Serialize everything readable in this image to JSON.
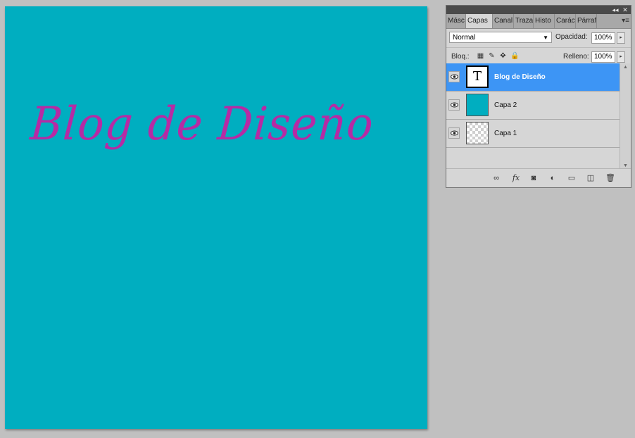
{
  "canvas": {
    "background": "#00aec0",
    "text": "Blog de Diseño",
    "text_color": "#b62ba4"
  },
  "panel": {
    "top_buttons": [
      "◂◂",
      "✕"
    ],
    "tabs": [
      {
        "label": "Másc",
        "active": false
      },
      {
        "label": "Capas",
        "active": true
      },
      {
        "label": "Canal",
        "active": false
      },
      {
        "label": "Traza",
        "active": false
      },
      {
        "label": "Histo",
        "active": false
      },
      {
        "label": "Caráct",
        "active": false
      },
      {
        "label": "Párraf",
        "active": false
      }
    ],
    "menu_icon": "panel-menu-icon",
    "blend_mode": "Normal",
    "opacity_label": "Opacidad:",
    "opacity_value": "100%",
    "lock_label": "Bloq.:",
    "fill_label": "Relleno:",
    "fill_value": "100%",
    "layers": [
      {
        "name": "Blog de Diseño",
        "thumb": "text",
        "selected": true
      },
      {
        "name": "Capa 2",
        "thumb": "color",
        "selected": false
      },
      {
        "name": "Capa 1",
        "thumb": "transparent",
        "selected": false
      }
    ],
    "footer_icons": [
      "link-icon",
      "fx-icon",
      "mask-icon",
      "adjustment-icon",
      "folder-icon",
      "new-layer-icon",
      "trash-icon"
    ]
  }
}
